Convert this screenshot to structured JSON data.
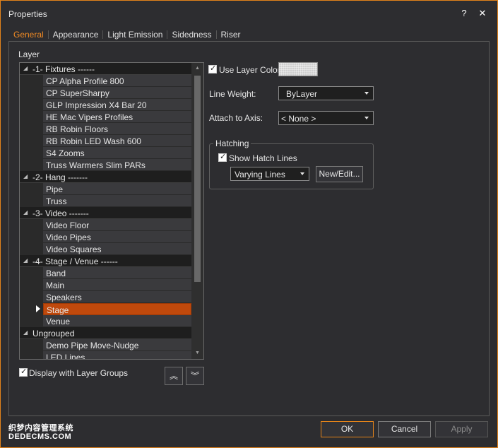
{
  "window": {
    "title": "Properties",
    "help_glyph": "?",
    "close_glyph": "✕"
  },
  "tabs": [
    {
      "label": "General",
      "active": true
    },
    {
      "label": "Appearance",
      "active": false
    },
    {
      "label": "Light Emission",
      "active": false
    },
    {
      "label": "Sidedness",
      "active": false
    },
    {
      "label": "Riser",
      "active": false
    }
  ],
  "layer": {
    "label": "Layer",
    "groups": [
      {
        "name": "-1- Fixtures ------",
        "items": [
          "CP Alpha Profile 800",
          "CP SuperSharpy",
          "GLP Impression X4 Bar 20",
          "HE Mac Vipers Profiles",
          "RB Robin Floors",
          "RB Robin LED Wash 600",
          "S4 Zooms",
          "Truss Warmers Slim PARs"
        ]
      },
      {
        "name": "-2- Hang -------",
        "items": [
          "Pipe",
          "Truss"
        ]
      },
      {
        "name": "-3- Video -------",
        "items": [
          "Video Floor",
          "Video Pipes",
          "Video Squares"
        ]
      },
      {
        "name": "-4- Stage / Venue ------",
        "items": [
          "Band",
          "Main",
          "Speakers",
          "Stage",
          "Venue"
        ]
      },
      {
        "name": "Ungrouped",
        "items": [
          "Demo Pipe Move-Nudge",
          "LED Lines"
        ]
      }
    ],
    "selected_item": "Stage",
    "display_with_groups_label": "Display with Layer Groups",
    "display_with_groups_checked": true,
    "move_up_glyph": "︽",
    "move_down_glyph": "︾"
  },
  "props": {
    "use_layer_color_label": "Use Layer Color",
    "use_layer_color_checked": true,
    "line_weight_label": "Line Weight:",
    "line_weight_value": "ByLayer",
    "attach_axis_label": "Attach to Axis:",
    "attach_axis_value": "< None >",
    "hatching_title": "Hatching",
    "show_hatch_label": "Show Hatch Lines",
    "show_hatch_checked": true,
    "hatch_style_value": "Varying Lines",
    "new_edit_label": "New/Edit..."
  },
  "footer": {
    "ok": "OK",
    "cancel": "Cancel",
    "apply": "Apply",
    "watermark_line1": "织梦内容管理系统",
    "watermark_line2": "DEDECMS.COM"
  },
  "colors": {
    "accent": "#e3831a",
    "selected_row": "#c0490c",
    "active_tab": "#f08a24"
  }
}
